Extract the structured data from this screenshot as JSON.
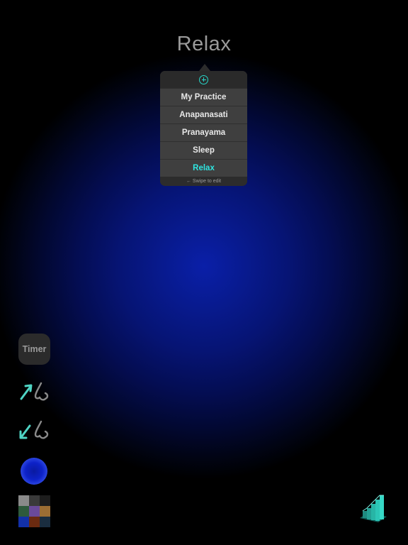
{
  "header": {
    "title": "Relax"
  },
  "popover": {
    "add_icon": "plus-circle-icon",
    "items": [
      {
        "label": "My Practice",
        "selected": false
      },
      {
        "label": "Anapanasati",
        "selected": false
      },
      {
        "label": "Pranayama",
        "selected": false
      },
      {
        "label": "Sleep",
        "selected": false
      },
      {
        "label": "Relax",
        "selected": true
      }
    ],
    "hint": "← Swipe to edit"
  },
  "toolbar": {
    "timer_label": "Timer",
    "breathe_in_icon": "inhale-nose-icon",
    "breathe_out_icon": "exhale-nose-icon",
    "orb_icon": "blue-orb-icon",
    "palette_icon": "color-palette-icon",
    "palette_colors": [
      "#8a8a8a",
      "#3a3a3a",
      "#1d1d1d",
      "#2e5a3c",
      "#6a4a9a",
      "#9c6e34",
      "#1230a8",
      "#6a2a10",
      "#1a2d3f"
    ],
    "stats_icon": "bar-stats-icon"
  },
  "colors": {
    "accent": "#2fe5e0",
    "background_glow": "#0a1fa8"
  }
}
